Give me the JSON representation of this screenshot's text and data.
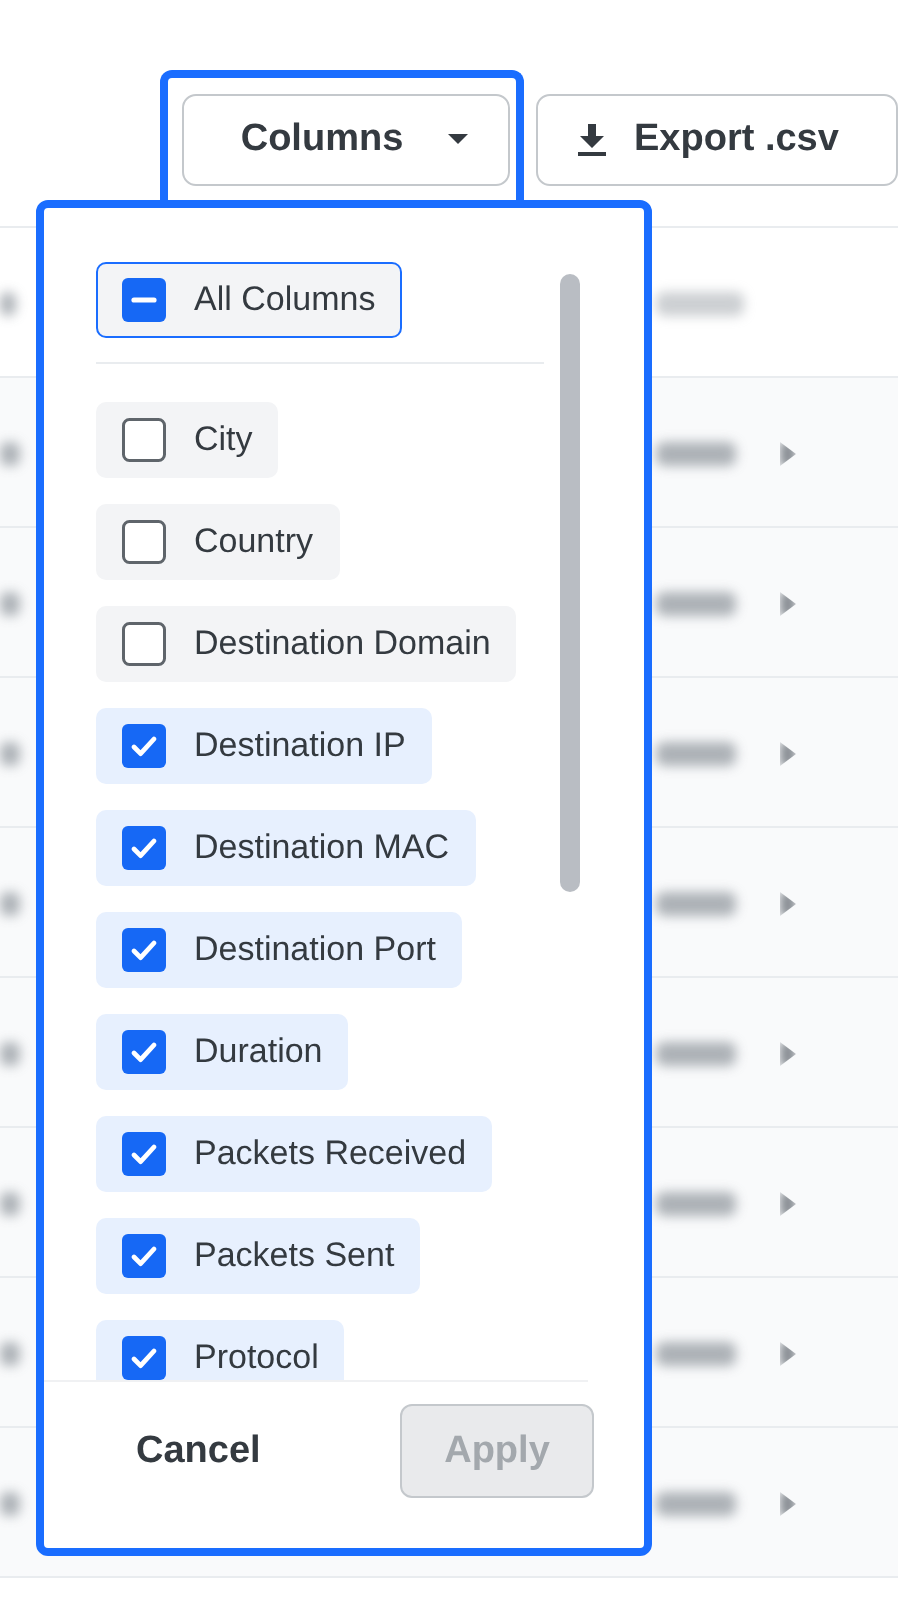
{
  "toolbar": {
    "columns_button": {
      "label": "Columns",
      "highlighted": true
    },
    "export_button": {
      "label": "Export .csv"
    }
  },
  "column_picker": {
    "highlighted": true,
    "all_columns": {
      "label": "All Columns",
      "checked": true,
      "partial": true
    },
    "options": [
      {
        "label": "City",
        "checked": false
      },
      {
        "label": "Country",
        "checked": false
      },
      {
        "label": "Destination Domain",
        "checked": false
      },
      {
        "label": "Destination IP",
        "checked": true
      },
      {
        "label": "Destination MAC",
        "checked": true
      },
      {
        "label": "Destination Port",
        "checked": true
      },
      {
        "label": "Duration",
        "checked": true
      },
      {
        "label": "Packets Received",
        "checked": true
      },
      {
        "label": "Packets Sent",
        "checked": true
      },
      {
        "label": "Protocol",
        "checked": true
      }
    ],
    "cancel_button": "Cancel",
    "apply_button": {
      "label": "Apply",
      "disabled": true
    }
  }
}
